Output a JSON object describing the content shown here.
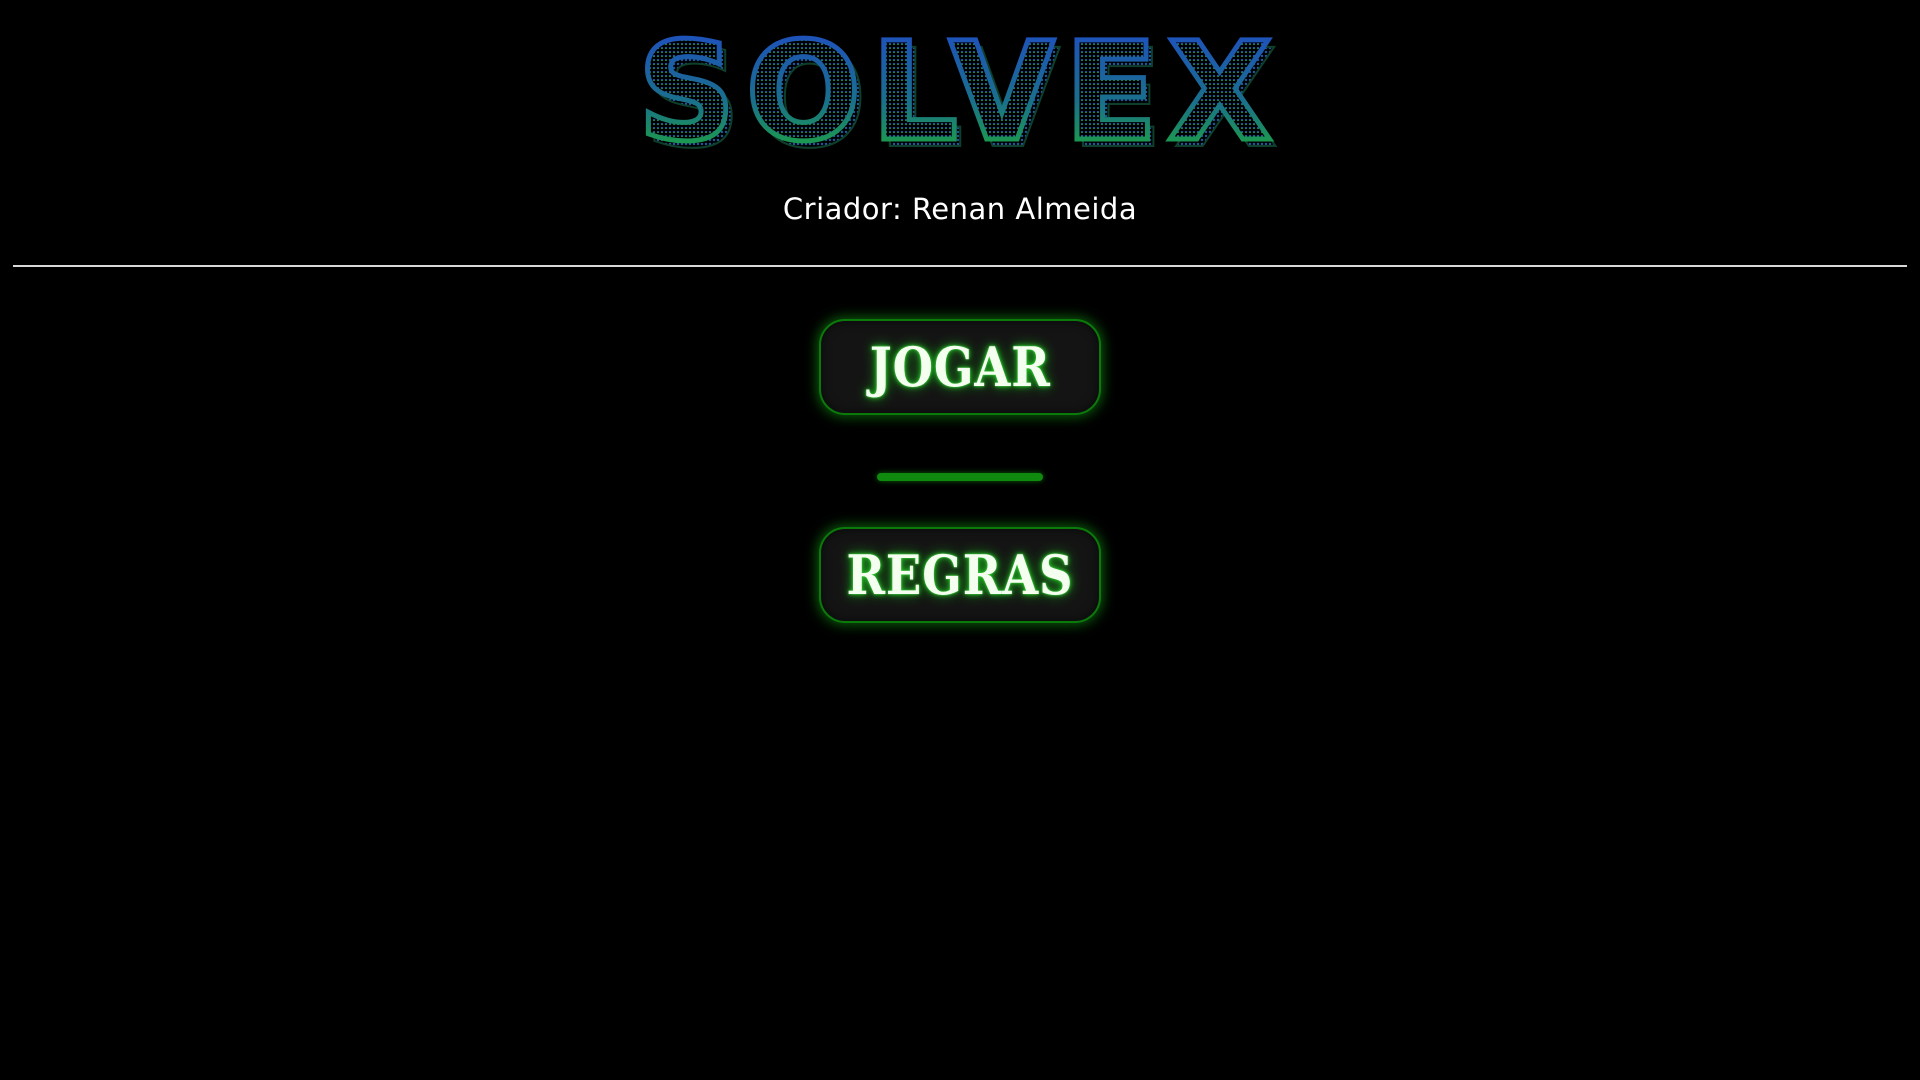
{
  "header": {
    "title": "SOLVEX",
    "creator": "Criador: Renan Almeida"
  },
  "menu": {
    "play_label": "JOGAR",
    "rules_label": "REGRAS"
  },
  "colors": {
    "background": "#000000",
    "title_gradient_top": "#1f49c9",
    "title_gradient_bottom": "#1db526",
    "button_glow": "#1aa51a",
    "separator": "#0f8a0f"
  }
}
